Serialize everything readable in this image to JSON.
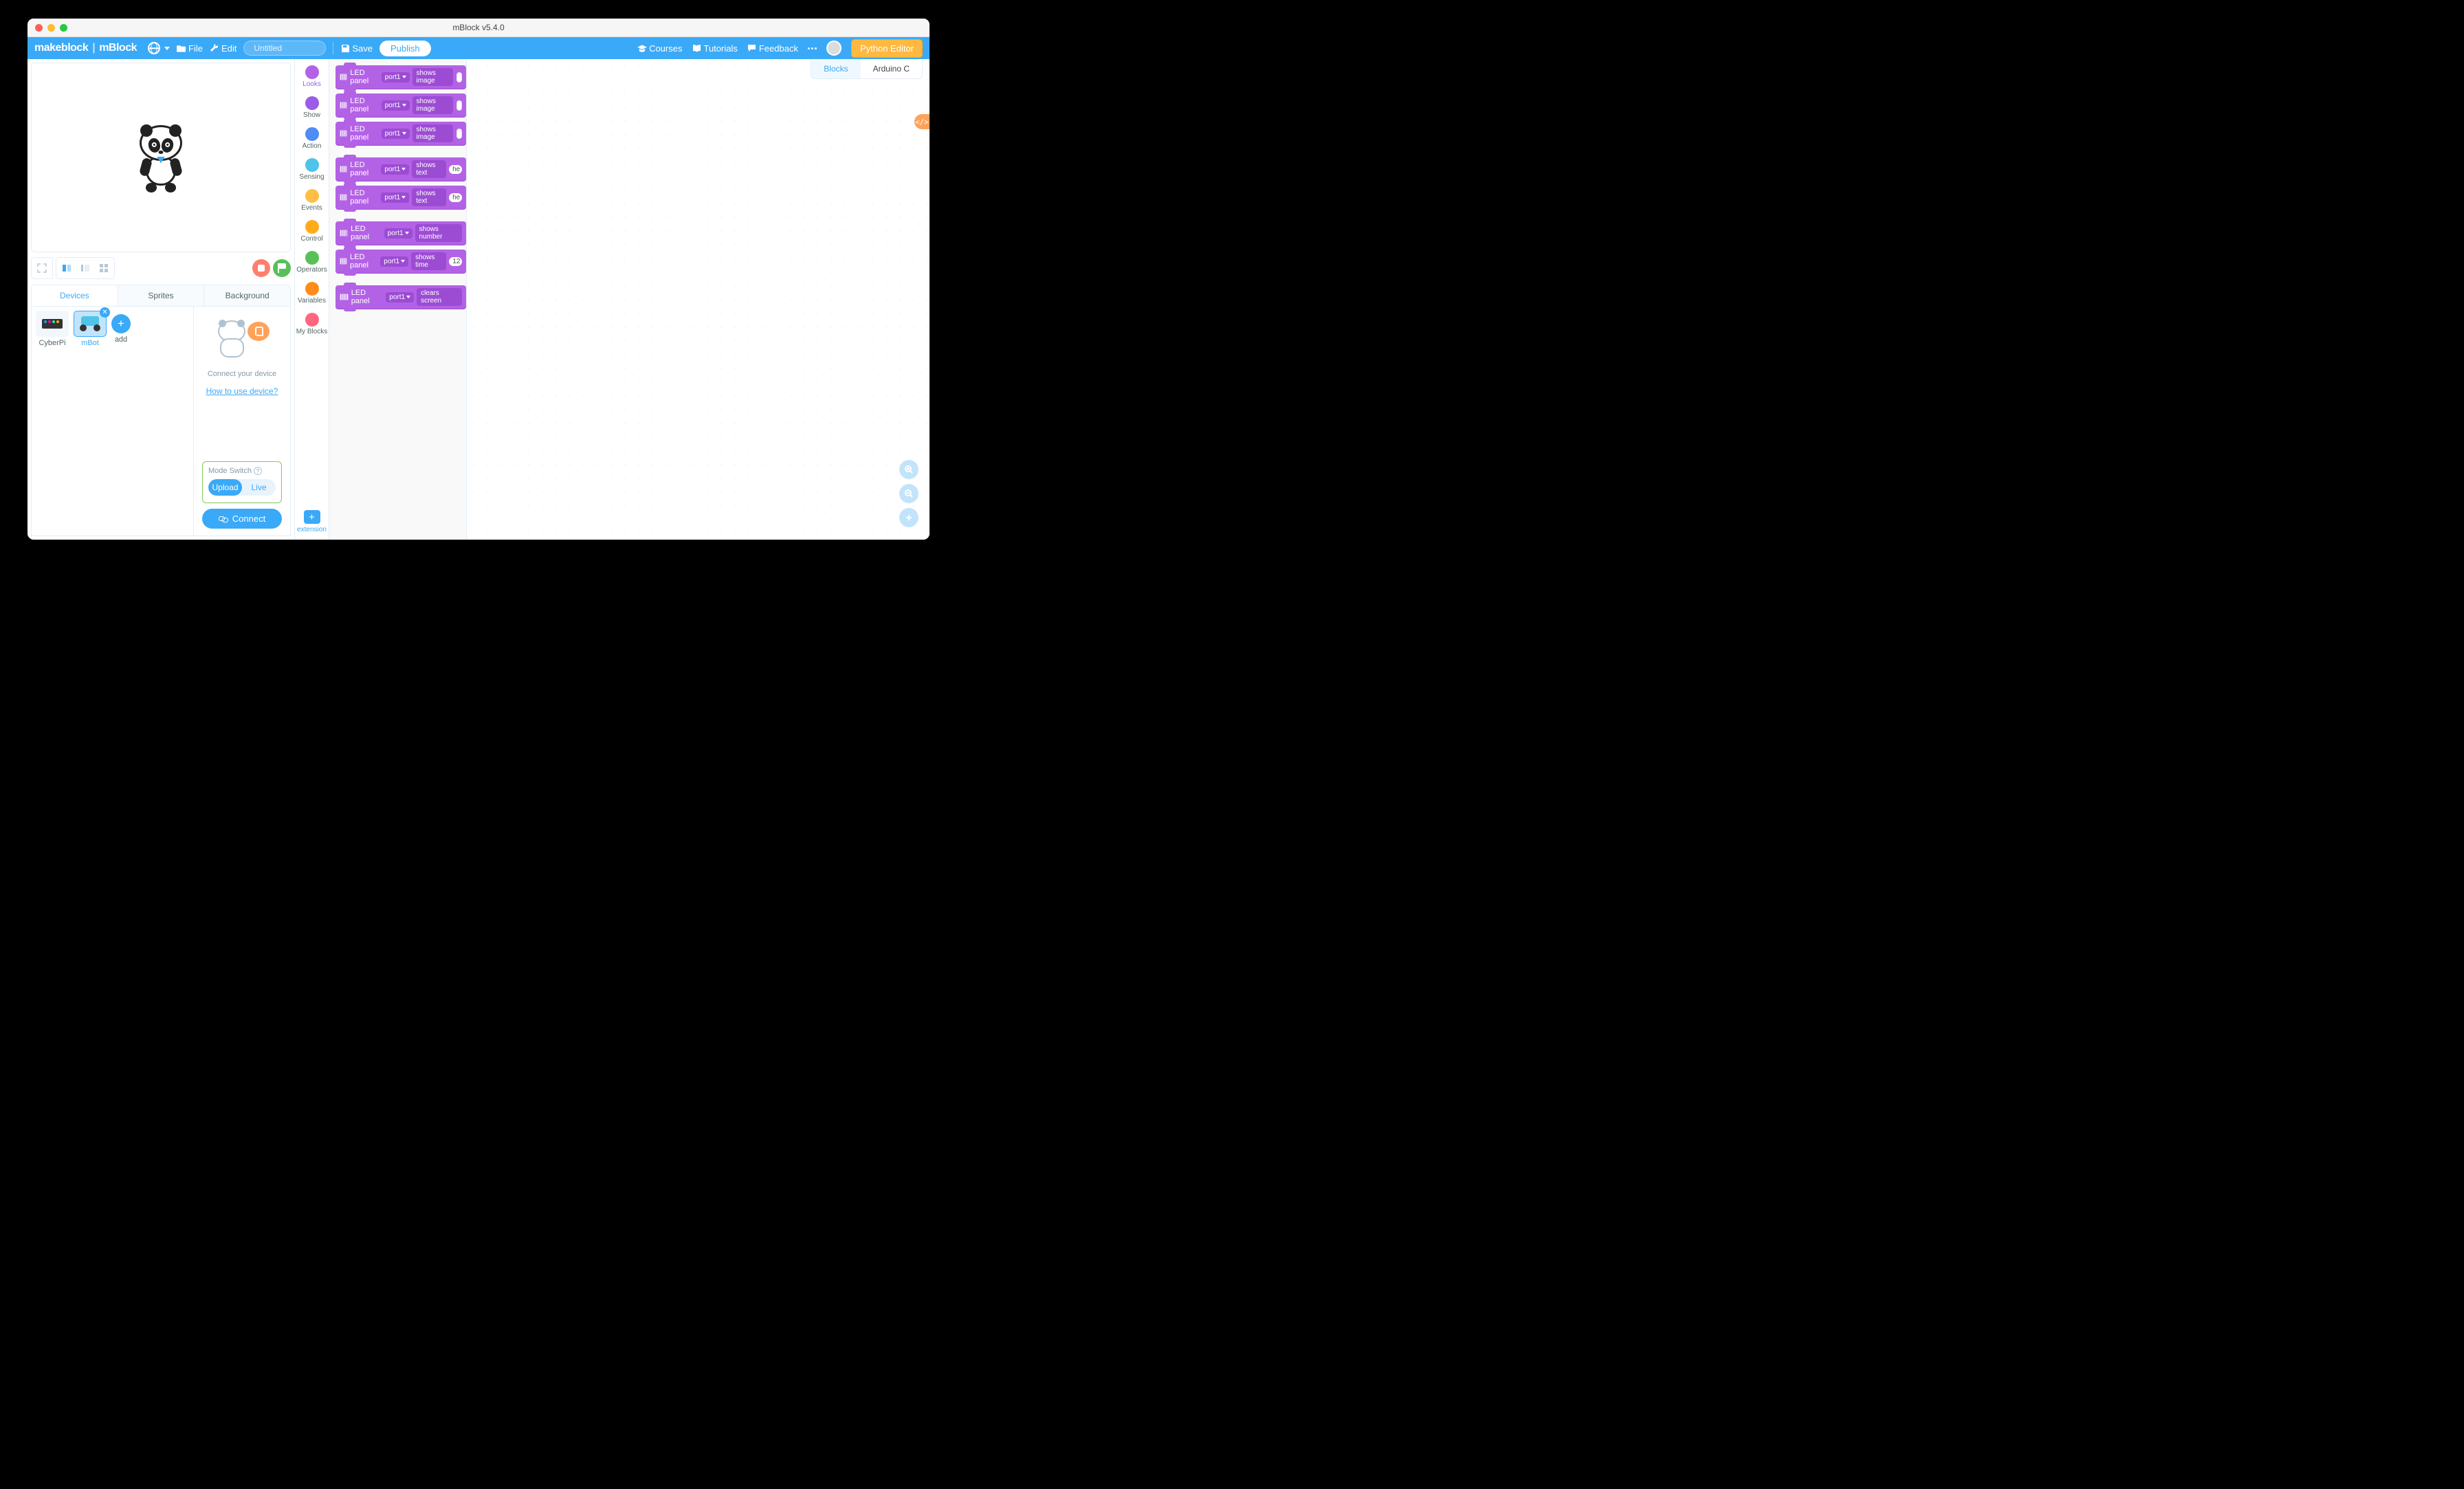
{
  "window": {
    "title": "mBlock v5.4.0"
  },
  "topbar": {
    "brand1": "makeblock",
    "brand2": "mBlock",
    "file": "File",
    "edit": "Edit",
    "project": "Untitled",
    "save": "Save",
    "publish": "Publish",
    "courses": "Courses",
    "tutorials": "Tutorials",
    "feedback": "Feedback",
    "pythonEditor": "Python Editor"
  },
  "tabs": {
    "devices": "Devices",
    "sprites": "Sprites",
    "background": "Background"
  },
  "devices": {
    "items": [
      {
        "name": "CyberPi",
        "selected": false
      },
      {
        "name": "mBot",
        "selected": true
      }
    ],
    "add": "add",
    "connectPrompt": "Connect your device",
    "howTo": "How to use device?",
    "modeTitle": "Mode Switch",
    "modeUpload": "Upload",
    "modeLive": "Live",
    "connect": "Connect"
  },
  "categories": [
    {
      "label": "Looks",
      "color": "#b362e6",
      "active": true
    },
    {
      "label": "Show",
      "color": "#9b5de5"
    },
    {
      "label": "Action",
      "color": "#4f8cf5"
    },
    {
      "label": "Sensing",
      "color": "#4fc3e8"
    },
    {
      "label": "Events",
      "color": "#ffbf47"
    },
    {
      "label": "Control",
      "color": "#ffab19"
    },
    {
      "label": "Operators",
      "color": "#59c059"
    },
    {
      "label": "Variables",
      "color": "#ff8c1a"
    },
    {
      "label": "My Blocks",
      "color": "#ff6680"
    }
  ],
  "extension": {
    "label": "extension"
  },
  "blocks": {
    "panel": "LED panel",
    "port": "port1",
    "items": [
      {
        "action": "shows image",
        "tail": "image"
      },
      {
        "action": "shows image",
        "tail": "image"
      },
      {
        "action": "shows image",
        "tail": "image",
        "spaced": false
      },
      {
        "action": "shows text",
        "tail": "round",
        "val": "he",
        "spaced": true
      },
      {
        "action": "shows text",
        "tail": "round",
        "val": "he"
      },
      {
        "action": "shows number",
        "tail": "none",
        "spaced": true
      },
      {
        "action": "shows time",
        "tail": "round",
        "val": "12"
      },
      {
        "action": "clears screen",
        "tail": "none",
        "spaced": true
      }
    ]
  },
  "codeTabs": {
    "blocks": "Blocks",
    "arduino": "Arduino C"
  },
  "colors": {
    "primary": "#3aa9f7",
    "looks": "#b362e6",
    "accent": "#ffb940"
  }
}
